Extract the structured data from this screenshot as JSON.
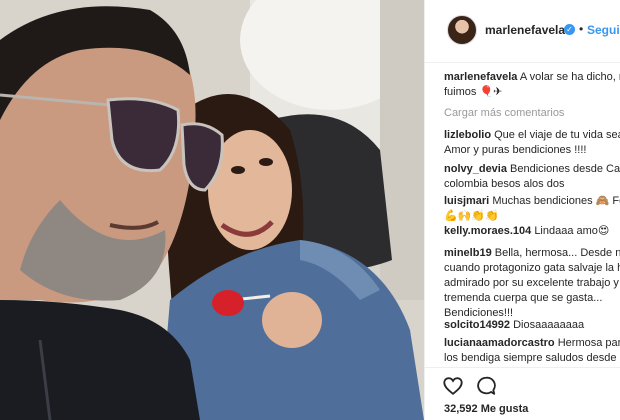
{
  "post": {
    "username": "marlenefavela",
    "follow_label": "Seguir",
    "separator": "•"
  },
  "caption": {
    "username": "marlenefavela",
    "line1": "A volar se ha dicho, n",
    "line2": "fuimos 🎈✈"
  },
  "load_more_label": "Cargar más comentarios",
  "comments": [
    {
      "username": "lizlebolio",
      "line1": "Que el viaje de tu vida sea",
      "line2": "Amor y puras bendiciones !!!!"
    },
    {
      "username": "nolvy_devia",
      "line1": "Bendiciones desde Cali",
      "line2": "colombia besos alos dos"
    },
    {
      "username": "luisjmari",
      "line1": "Muchas bendiciones 🙈 Fel",
      "line2": "💪🙌👏👏"
    },
    {
      "username": "kelly.moraes.104",
      "line1": "Lindaaa amo😍",
      "line2": ""
    },
    {
      "username": "minelb19",
      "line1": "Bella, hermosa... Desde nir",
      "line2": "cuando protagonizo gata salvaje la h",
      "line3": "admirado por su excelente trabajo y",
      "line4": "tremenda cuerpa que se gasta...",
      "line5": "Bendiciones!!!"
    },
    {
      "username": "solcito14992",
      "line1": "Diosaaaaaaaa",
      "line2": ""
    },
    {
      "username": "lucianaamadorcastro",
      "line1": "Hermosa pare",
      "line2": "los bendiga siempre saludos desde"
    }
  ],
  "actions": {
    "like_icon": "heart-icon",
    "comment_icon": "speech-bubble-icon",
    "likes_label": "32,592 Me gusta"
  },
  "colors": {
    "link_blue": "#3897f0",
    "text": "#262626",
    "muted": "#999999",
    "divider": "#efefef"
  }
}
